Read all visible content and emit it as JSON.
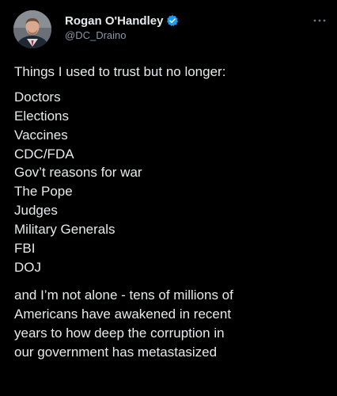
{
  "author": {
    "display_name": "Rogan O'Handley",
    "handle": "@DC_Draino",
    "verified_icon": "verified-badge-icon",
    "verified_color": "#1d9bf0"
  },
  "menu_icon": "more-icon",
  "tweet": {
    "intro": "Things I used to trust but no longer:",
    "items": [
      "Doctors",
      "Elections",
      "Vaccines",
      "CDC/FDA",
      "Gov’t reasons for war",
      "The Pope",
      "Judges",
      "Military Generals",
      "FBI",
      "DOJ"
    ],
    "outro_lines": [
      "and I’m not alone - tens of millions of",
      "Americans have awakened in recent",
      "years to how deep the corruption in",
      "our government has metastasized"
    ]
  },
  "colors": {
    "background": "#000000",
    "text_primary": "#e7e9ea",
    "text_secondary": "#8b98a5"
  }
}
